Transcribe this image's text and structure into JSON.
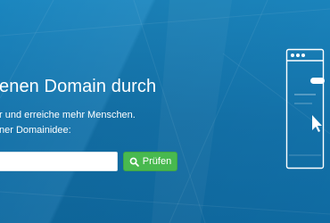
{
  "hero": {
    "headline": "enen Domain durch",
    "description_line1": "r und erreiche mehr Menschen.",
    "description_line2": "ner Domainidee:"
  },
  "search": {
    "input_value": "",
    "input_placeholder": "",
    "button_label": "Prüfen",
    "button_icon": "search-icon"
  },
  "illustration": {
    "icon": "browser-window-icon"
  },
  "colors": {
    "background": "#1576ad",
    "button": "#48b94f",
    "text": "#ffffff"
  }
}
